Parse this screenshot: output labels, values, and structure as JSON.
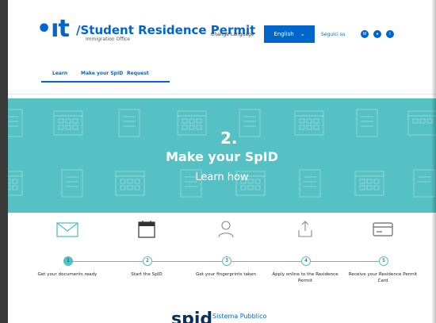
{
  "header": {
    "logo": "•ıt",
    "title": "/Student Residence Permit",
    "subtitle": "Immigration Office",
    "change_language_label": "Change Language",
    "language": "English",
    "follow_label": "Seguici su",
    "social_icons": [
      "medium-icon",
      "github-icon",
      "twitter-icon"
    ]
  },
  "nav": {
    "items": [
      {
        "label": "Learn"
      },
      {
        "label": "Make your SpID"
      },
      {
        "label": "Request"
      }
    ]
  },
  "hero": {
    "number": "2.",
    "title": "Make your SpID",
    "link": "Learn how"
  },
  "steps": [
    {
      "number": "1",
      "label": "Get your documents ready",
      "icon": "envelope-icon",
      "active": true
    },
    {
      "number": "2",
      "label": "Start the SpID",
      "icon": "calendar-icon",
      "active": false
    },
    {
      "number": "3",
      "label": "Get your fingerprints taken",
      "icon": "user-icon",
      "active": false
    },
    {
      "number": "4",
      "label": "Apply online to the Residence Permit",
      "icon": "upload-icon",
      "active": false
    },
    {
      "number": "5",
      "label": "Receive your Residence Permit Card",
      "icon": "card-icon",
      "active": false
    }
  ],
  "footer": {
    "spid_logo": "spid",
    "spid_text": "Sistema Pubblico"
  },
  "colors": {
    "brand_blue": "#0066cc",
    "hero_teal": "#56c1c4"
  }
}
